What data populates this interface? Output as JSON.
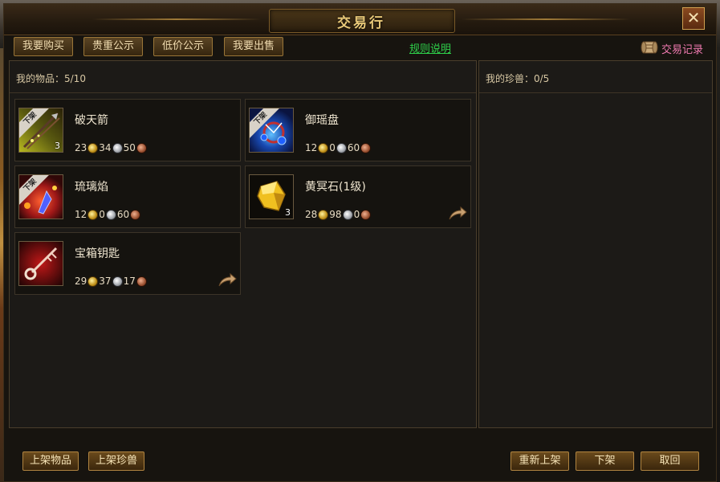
{
  "window": {
    "title": "交易行",
    "close_label": "✕"
  },
  "tabs": [
    {
      "label": "我要购买"
    },
    {
      "label": "贵重公示"
    },
    {
      "label": "低价公示"
    },
    {
      "label": "我要出售"
    }
  ],
  "rules_link": "规则说明",
  "record_label": "交易记录",
  "left_panel": {
    "title": "我的物品：5/10"
  },
  "right_panel": {
    "title": "我的珍兽：0/5"
  },
  "badge_label": "下架",
  "items": [
    {
      "name": "破天箭",
      "qty": "3",
      "gold": "23",
      "silver": "34",
      "copper": "50",
      "delisted": true,
      "icon": "arrow-icon"
    },
    {
      "name": "御瑶盘",
      "qty": "",
      "gold": "12",
      "silver": "0",
      "copper": "60",
      "delisted": true,
      "icon": "disc-icon"
    },
    {
      "name": "琉璃焰",
      "qty": "",
      "gold": "12",
      "silver": "0",
      "copper": "60",
      "delisted": true,
      "icon": "flame-icon"
    },
    {
      "name": "黄冥石(1级)",
      "qty": "3",
      "gold": "28",
      "silver": "98",
      "copper": "0",
      "delisted": false,
      "icon": "yellow-gem-icon"
    },
    {
      "name": "宝箱钥匙",
      "qty": "",
      "gold": "29",
      "silver": "37",
      "copper": "17",
      "delisted": false,
      "icon": "key-icon"
    }
  ],
  "buttons": {
    "list_item": "上架物品",
    "list_pet": "上架珍兽",
    "relist": "重新上架",
    "delist": "下架",
    "cancel": "取回"
  },
  "colors": {
    "accent_gold": "#e8c878",
    "link_green": "#2ed04a",
    "record_pink": "#f07ab0"
  }
}
